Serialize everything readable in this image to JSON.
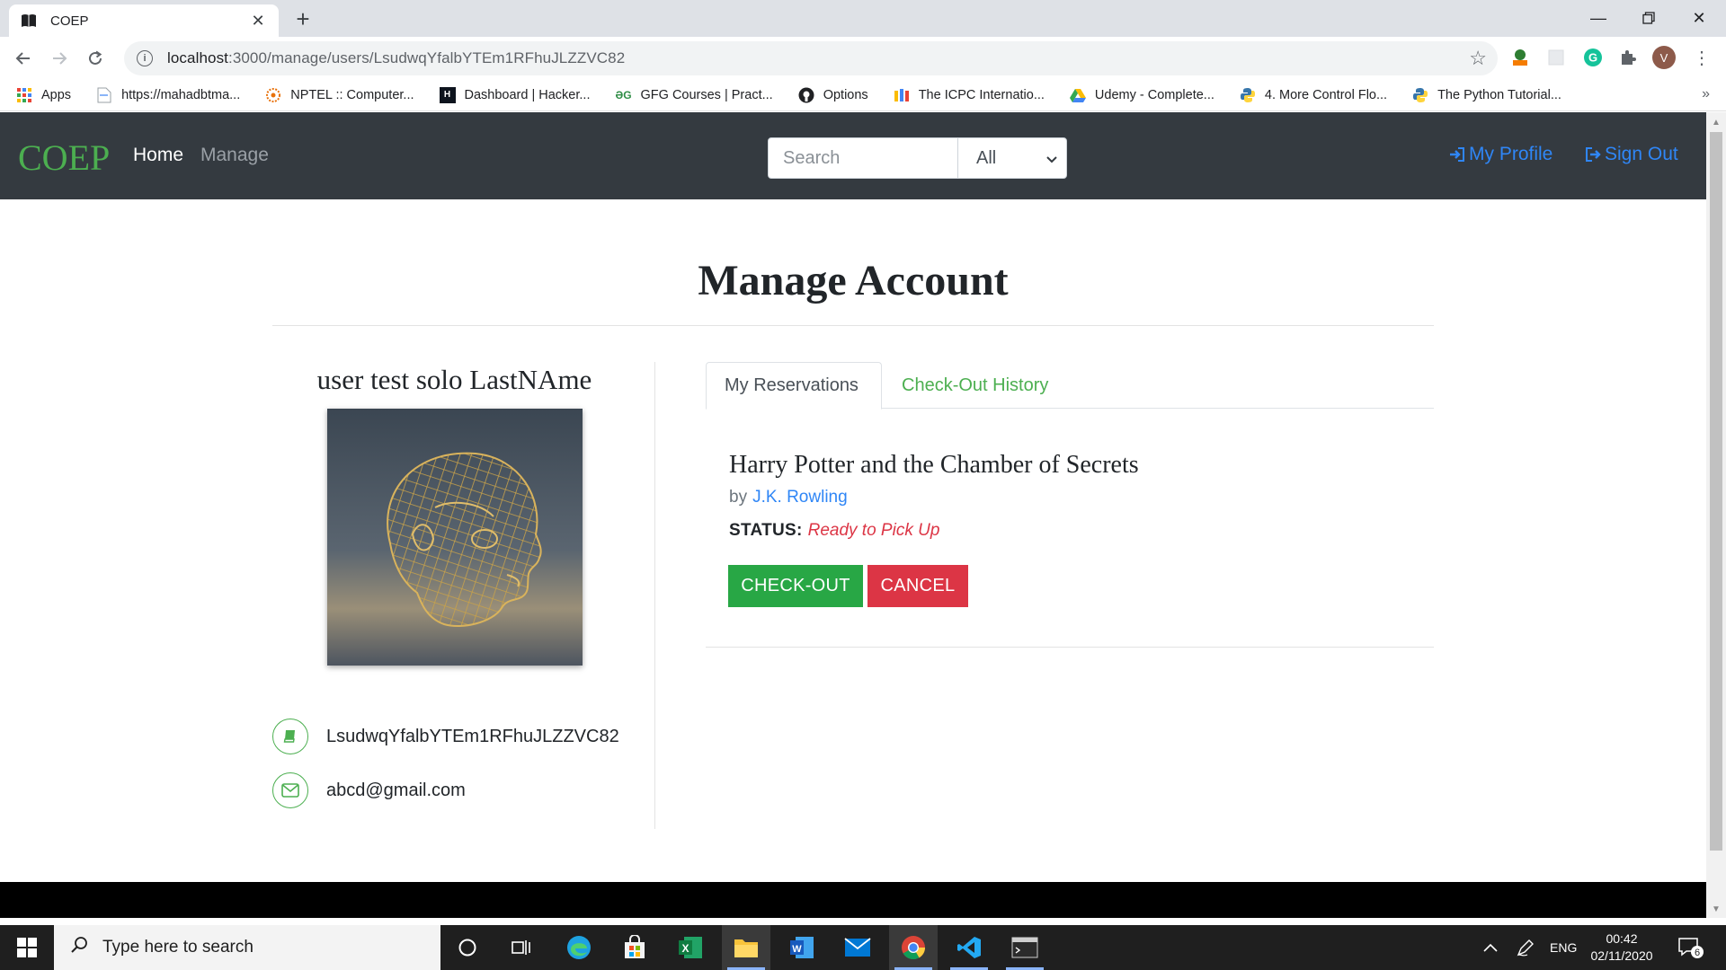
{
  "browser": {
    "tab_title": "COEP",
    "url_host": "localhost",
    "url_path": ":3000/manage/users/LsudwqYfalbYTEm1RFhuJLZZVC82",
    "profile_initial": "V",
    "bookmarks": [
      {
        "label": "Apps",
        "icon": "apps-grid-icon"
      },
      {
        "label": "https://mahadbtma...",
        "icon": "page-icon"
      },
      {
        "label": "NPTEL :: Computer...",
        "icon": "nptel-icon"
      },
      {
        "label": "Dashboard | Hacker...",
        "icon": "hackerrank-icon"
      },
      {
        "label": "GFG Courses | Pract...",
        "icon": "gfg-icon"
      },
      {
        "label": "Options",
        "icon": "github-icon"
      },
      {
        "label": "The ICPC Internatio...",
        "icon": "icpc-icon"
      },
      {
        "label": "Udemy - Complete...",
        "icon": "drive-icon"
      },
      {
        "label": "4. More Control Flo...",
        "icon": "python-icon"
      },
      {
        "label": "The Python Tutorial...",
        "icon": "python-icon"
      }
    ]
  },
  "site": {
    "brand": "COEP",
    "nav": {
      "home": "Home",
      "manage": "Manage"
    },
    "search": {
      "placeholder": "Search",
      "filter_selected": "All"
    },
    "right": {
      "profile": "My Profile",
      "signout": "Sign Out"
    }
  },
  "page": {
    "title": "Manage Account",
    "user": {
      "name": "user test solo LastNAme",
      "card_id": "LsudwqYfalbYTEm1RFhuJLZZVC82",
      "email": "abcd@gmail.com"
    },
    "tabs": [
      {
        "label": "My Reservations",
        "active": true
      },
      {
        "label": "Check-Out History",
        "active": false
      }
    ],
    "reservation": {
      "title": "Harry Potter and the Chamber of Secrets",
      "by": "by",
      "author": "J.K. Rowling",
      "status_label": "STATUS:",
      "status_value": "Ready to Pick Up",
      "checkout_button": "CHECK-OUT",
      "cancel_button": "CANCEL"
    }
  },
  "taskbar": {
    "search_placeholder": "Type here to search",
    "language": "ENG",
    "time": "00:42",
    "date": "02/11/2020",
    "notification_count": "6"
  },
  "colors": {
    "brand_green": "#4caf50",
    "link_blue": "#2f86f6",
    "danger_red": "#dc3545",
    "success_green": "#28a745",
    "navbar_bg": "#343a40"
  }
}
